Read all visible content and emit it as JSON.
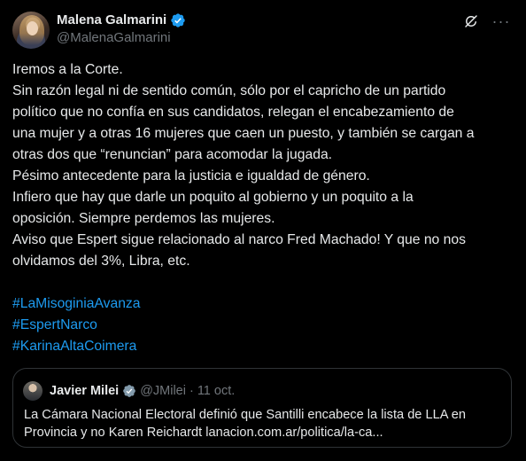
{
  "author": {
    "display_name": "Malena Galmarini",
    "handle": "@MalenaGalmarini"
  },
  "tweet": {
    "lines": [
      "Iremos a la Corte.",
      "Sin razón legal ni de sentido común, sólo por el capricho de un partido",
      "político que no confía en sus candidatos, relegan el encabezamiento de",
      "una mujer y a otras 16 mujeres que caen un puesto, y también se cargan a",
      "otras dos que “renuncian” para acomodar la jugada.",
      "Pésimo antecedente para la justicia e igualdad de género.",
      "Infiero que hay que darle un poquito al gobierno y un poquito a la",
      "oposición. Siempre perdemos las mujeres.",
      "Aviso que Espert sigue relacionado al narco Fred Machado! Y que no nos",
      "olvidamos del 3%, Libra, etc."
    ],
    "hashtags": [
      "#LaMisoginiaAvanza",
      "#EspertNarco",
      "#KarinaAltaCoimera"
    ]
  },
  "quoted": {
    "display_name": "Javier Milei",
    "handle": "@JMilei",
    "separator": "·",
    "date": "11 oct.",
    "lines": [
      "La Cámara Nacional Electoral definió que Santilli encabece la lista de LLA en",
      "Provincia y no Karen Reichardt  lanacion.com.ar/politica/la-ca..."
    ]
  },
  "icons": {
    "verified": "verified-badge-icon",
    "grok": "grok-icon",
    "more": "more-icon"
  },
  "colors": {
    "background": "#000000",
    "text": "#e7e9ea",
    "muted": "#71767b",
    "link": "#1d9bf0",
    "verified": "#1d9bf0",
    "border": "#2f3336"
  }
}
